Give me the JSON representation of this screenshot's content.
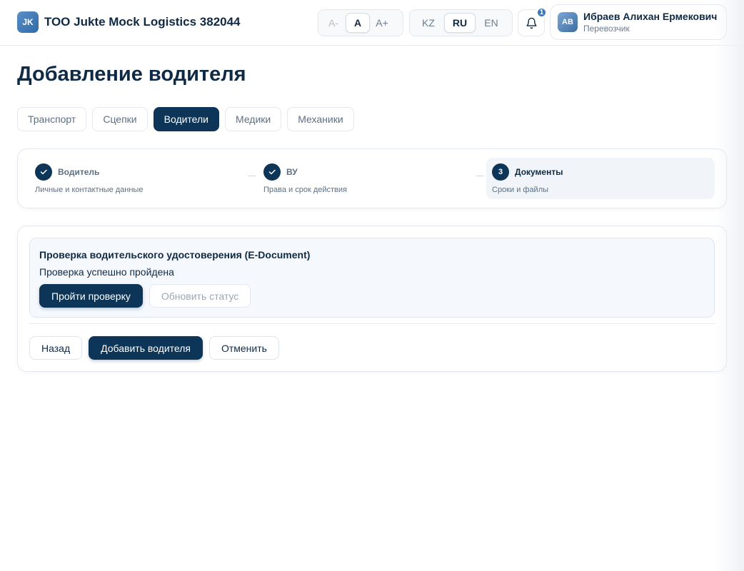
{
  "header": {
    "logo_initials": "JK",
    "company_name": "ТОО Jukte Mock Logistics 382044",
    "font_size": {
      "decrease": "A-",
      "normal": "A",
      "increase": "A+"
    },
    "languages": [
      "KZ",
      "RU",
      "EN"
    ],
    "active_language": "RU",
    "notifications_count": "1",
    "user": {
      "initials": "AB",
      "name": "Ибраев Алихан Ермекович",
      "role": "Перевозчик"
    }
  },
  "page": {
    "title": "Добавление водителя"
  },
  "tabs": [
    "Транспорт",
    "Сцепки",
    "Водители",
    "Медики",
    "Механики"
  ],
  "active_tab": "Водители",
  "steps": [
    {
      "marker": "check",
      "title": "Водитель",
      "subtitle": "Личные и контактные данные",
      "state": "done"
    },
    {
      "marker": "check",
      "title": "ВУ",
      "subtitle": "Права и срок действия",
      "state": "done"
    },
    {
      "marker": "3",
      "title": "Документы",
      "subtitle": "Сроки и файлы",
      "state": "active"
    }
  ],
  "verification": {
    "title": "Проверка водительского удостоверения (E-Document)",
    "status": "Проверка успешно пройдена",
    "check_button": "Пройти проверку",
    "refresh_button": "Обновить статус"
  },
  "actions": {
    "back": "Назад",
    "submit": "Добавить водителя",
    "cancel": "Отменить"
  }
}
